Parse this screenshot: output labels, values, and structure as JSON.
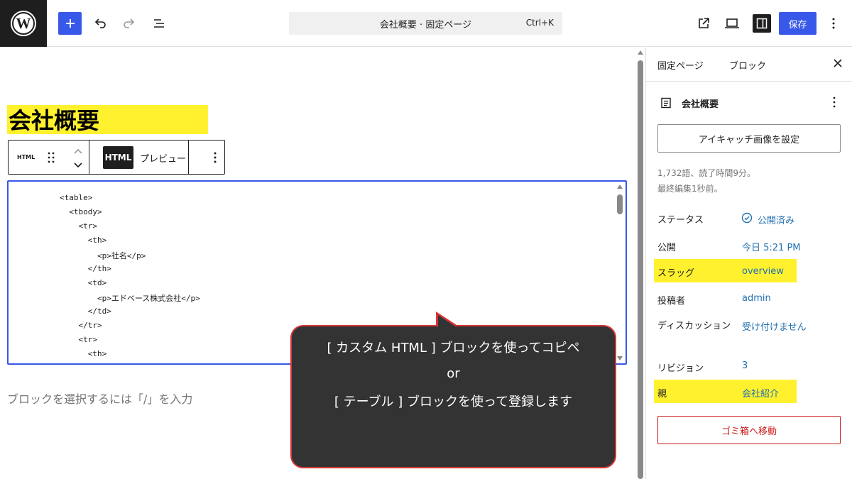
{
  "topbar": {
    "command_title": "会社概要 · 固定ページ",
    "command_shortcut": "Ctrl+K",
    "save_label": "保存"
  },
  "editor": {
    "page_title": "会社概要",
    "block_type_label": "HTML",
    "html_tab_label": "HTML",
    "preview_tab_label": "プレビュー",
    "code_lines": [
      "<table>",
      "  <tbody>",
      "    <tr>",
      "      <th>",
      "        <p>社名</p>",
      "      </th>",
      "      <td>",
      "        <p>エドベース株式会社</p>",
      "      </td>",
      "    </tr>",
      "    <tr>",
      "      <th>"
    ],
    "placeholder": "ブロックを選択するには「/」を入力"
  },
  "callout": {
    "line1": "[ カスタム HTML ] ブロックを使ってコピペ",
    "line2": "or",
    "line3": "[ テーブル ] ブロックを使って登録します"
  },
  "sidebar": {
    "tab_page": "固定ページ",
    "tab_block": "ブロック",
    "doc_title": "会社概要",
    "featured_image_label": "アイキャッチ画像を設定",
    "meta_words": "1,732語、読了時間9分。",
    "meta_edited": "最終編集1秒前。",
    "rows": {
      "status_label": "ステータス",
      "status_value": "公開済み",
      "publish_label": "公開",
      "publish_value": "今日 5:21 PM",
      "slug_label": "スラッグ",
      "slug_value": "overview",
      "author_label": "投稿者",
      "author_value": "admin",
      "discussion_label": "ディスカッション",
      "discussion_value": "受け付けません",
      "revisions_label": "リビジョン",
      "revisions_value": "3",
      "parent_label": "親",
      "parent_value": "会社紹介"
    },
    "trash_label": "ゴミ箱へ移動"
  },
  "colors": {
    "accent": "#3858e9",
    "highlight": "#fff12e",
    "callout_border": "#d63638",
    "link": "#2271b1",
    "danger": "#cc1818"
  }
}
